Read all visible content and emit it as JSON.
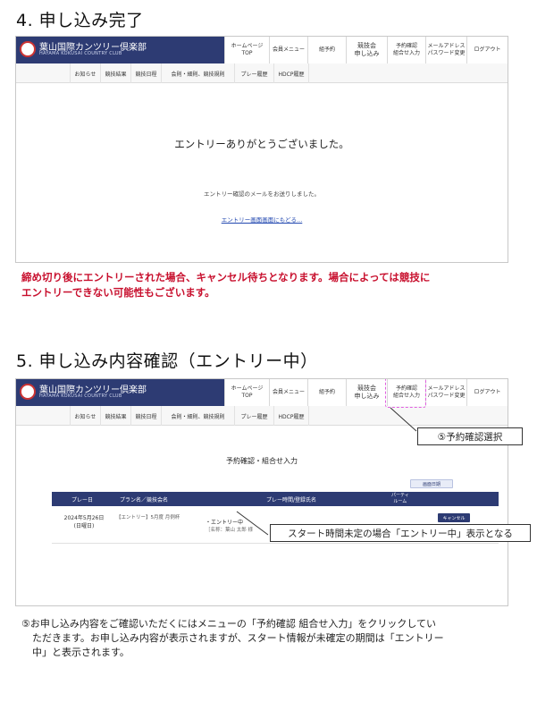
{
  "section4": {
    "heading": "4. 申し込み完了",
    "header": {
      "club_name": "葉山国際カンツリー倶楽部",
      "club_sub": "HAYAMA KOKUSAI COUNTRY CLUB",
      "nav": [
        {
          "label": "ホームページ\nTOP"
        },
        {
          "label": "会員メニュー"
        },
        {
          "label": "組予約"
        },
        {
          "label": "競技会\n申し込み"
        },
        {
          "label": "予約確認\n組合せ入力"
        },
        {
          "label": "メールアドレス\nパスワード変更"
        },
        {
          "label": "ログアウト"
        }
      ],
      "subnav": [
        "お知らせ",
        "競技結果",
        "競技日程",
        "会則・細則、競技規則",
        "プレー履歴",
        "HDCP履歴"
      ]
    },
    "thanks": "エントリーありがとうございました。",
    "mail_sent": "エントリー確認のメールをお送りしました。",
    "back_link": "エントリー画面画面にもどる..."
  },
  "warning": {
    "line1": "締め切り後にエントリーされた場合、キャンセル待ちとなります。場合によっては競技に",
    "line2": "エントリーできない可能性もございます。"
  },
  "section5": {
    "heading": "5. 申し込み内容確認（エントリー中）",
    "page_title": "予約確認・組合せ入力",
    "right_button": "画面日期",
    "table": {
      "headers": [
        "プレー日",
        "プラン名／競技会名",
        "プレー時間/登録氏名",
        "パーティ\nルーム"
      ],
      "row": {
        "date": "2024年5月26日",
        "weekday": "(日曜日)",
        "plan": "【エントリー】5月度 月例杯",
        "status": "・エントリー中",
        "name_line": "［名称：葉山 太郎 様",
        "cancel": "キャンセル"
      }
    },
    "callout_select": "⑤予約確認選択",
    "callout_entry": "スタート時間未定の場合「エントリー中」表示となる"
  },
  "footnote": {
    "line1": "⑤お申し込み内容をご確認いただくにはメニューの「予約確認 組合せ入力」をクリックしてい",
    "line2": "ただきます。お申し込み内容が表示されますが、スタート情報が未確定の期間は「エントリー",
    "line3": "中」と表示されます。"
  },
  "colors": {
    "navy": "#2d3b73",
    "warning_red": "#c8102e",
    "highlight_pink": "#e060e0"
  }
}
